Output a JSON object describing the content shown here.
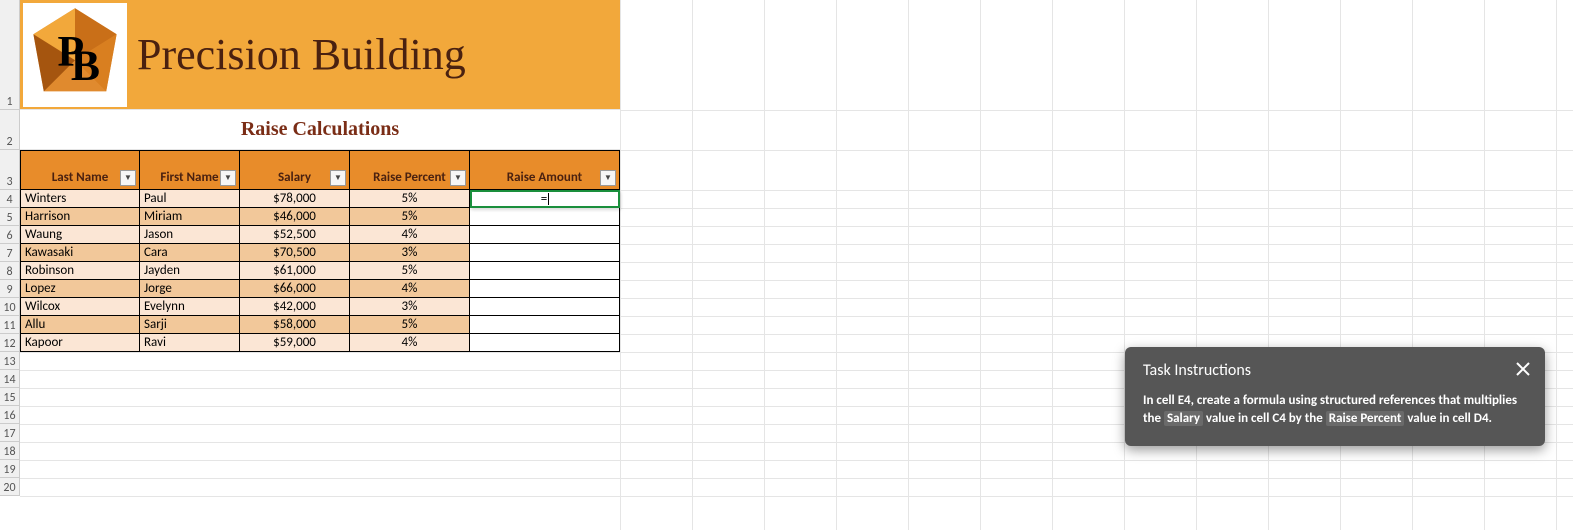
{
  "banner": {
    "title": "Precision Building",
    "subtitle": "Raise Calculations"
  },
  "table": {
    "headers": {
      "last": "Last Name",
      "first": "First Name",
      "salary": "Salary",
      "pct": "Raise Percent",
      "amt": "Raise Amount"
    },
    "rows": [
      {
        "last": "Winters",
        "first": "Paul",
        "salary": "$78,000",
        "pct": "5%",
        "amt": ""
      },
      {
        "last": "Harrison",
        "first": "Miriam",
        "salary": "$46,000",
        "pct": "5%",
        "amt": ""
      },
      {
        "last": "Waung",
        "first": "Jason",
        "salary": "$52,500",
        "pct": "4%",
        "amt": ""
      },
      {
        "last": "Kawasaki",
        "first": "Cara",
        "salary": "$70,500",
        "pct": "3%",
        "amt": ""
      },
      {
        "last": "Robinson",
        "first": "Jayden",
        "salary": "$61,000",
        "pct": "5%",
        "amt": ""
      },
      {
        "last": "Lopez",
        "first": "Jorge",
        "salary": "$66,000",
        "pct": "4%",
        "amt": ""
      },
      {
        "last": "Wilcox",
        "first": "Evelynn",
        "salary": "$42,000",
        "pct": "3%",
        "amt": ""
      },
      {
        "last": "Allu",
        "first": "Sarji",
        "salary": "$58,000",
        "pct": "5%",
        "amt": ""
      },
      {
        "last": "Kapoor",
        "first": "Ravi",
        "salary": "$59,000",
        "pct": "4%",
        "amt": ""
      }
    ]
  },
  "editing_cell": {
    "value": "="
  },
  "row_labels": [
    "1",
    "2",
    "3",
    "4",
    "5",
    "6",
    "7",
    "8",
    "9",
    "10",
    "11",
    "12",
    "13",
    "14",
    "15",
    "16",
    "17",
    "18",
    "19",
    "20"
  ],
  "tip": {
    "title": "Task Instructions",
    "t1": "In cell E4, create a formula using structured references that multiplies the ",
    "h1": "Salary",
    "t2": " value in cell C4 by the ",
    "h2": "Raise Percent",
    "t3": " value in cell D4."
  }
}
